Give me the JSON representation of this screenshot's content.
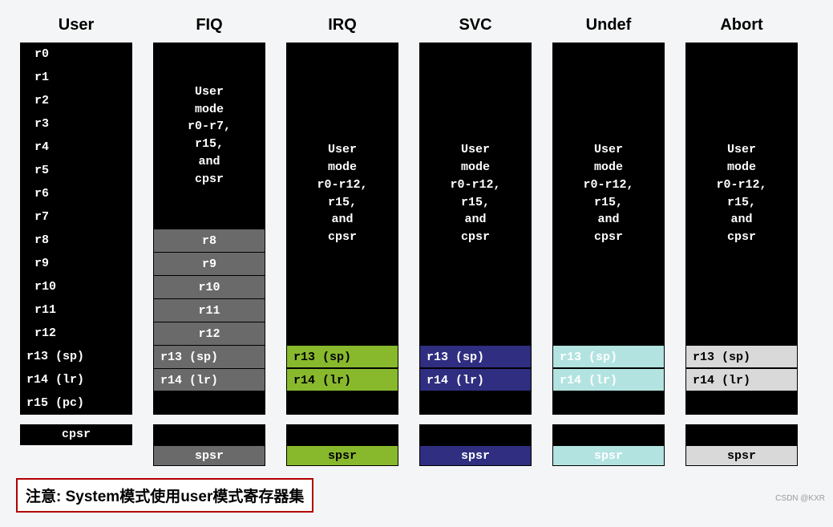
{
  "columns": {
    "user": {
      "header": "User"
    },
    "fiq": {
      "header": "FIQ"
    },
    "irq": {
      "header": "IRQ"
    },
    "svc": {
      "header": "SVC"
    },
    "undef": {
      "header": "Undef"
    },
    "abort": {
      "header": "Abort"
    }
  },
  "user_regs": {
    "r0": "r0",
    "r1": "r1",
    "r2": "r2",
    "r3": "r3",
    "r4": "r4",
    "r5": "r5",
    "r6": "r6",
    "r7": "r7",
    "r8": "r8",
    "r9": "r9",
    "r10": "r10",
    "r11": "r11",
    "r12": "r12",
    "r13": "r13 (sp)",
    "r14": "r14 (lr)",
    "r15": "r15 (pc)"
  },
  "fiq": {
    "desc_l1": "User",
    "desc_l2": "mode",
    "desc_l3": "r0-r7,",
    "desc_l4": "r15,",
    "desc_l5": "and",
    "desc_l6": "cpsr",
    "r8": "r8",
    "r9": "r9",
    "r10": "r10",
    "r11": "r11",
    "r12": "r12",
    "r13": "r13 (sp)",
    "r14": "r14 (lr)"
  },
  "shared_desc": {
    "l1": "User",
    "l2": "mode",
    "l3": "r0-r12,",
    "l4": "r15,",
    "l5": "and",
    "l6": "cpsr"
  },
  "banked": {
    "r13": "r13 (sp)",
    "r14": "r14 (lr)"
  },
  "cpsr": "cpsr",
  "spsr": "spsr",
  "note": "注意: System模式使用user模式寄存器集",
  "watermark": "CSDN @KXR"
}
